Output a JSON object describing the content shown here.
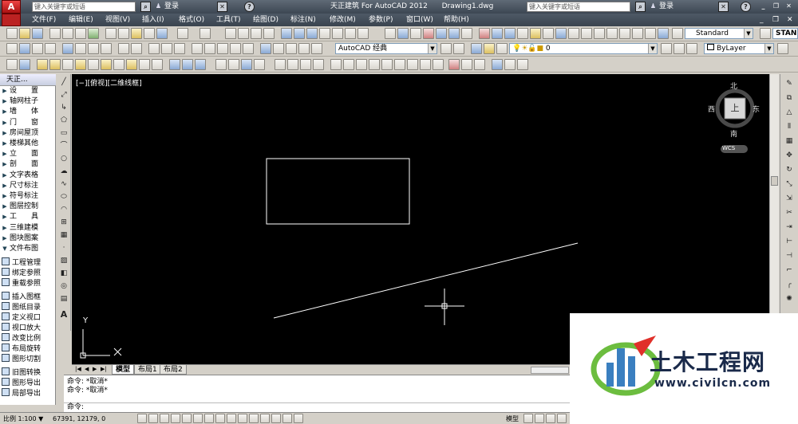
{
  "title_bar": {
    "app_title": "天正建筑 For AutoCAD 2012",
    "drawing": "Drawing1.dwg",
    "search_placeholder_left": "键入关键字或短语",
    "search_placeholder_right": "键入关键字或短语",
    "login_left": "登录",
    "login_right": "登录"
  },
  "menu": [
    "文件(F)",
    "编辑(E)",
    "视图(V)",
    "插入(I)",
    "格式(O)",
    "工具(T)",
    "绘图(D)",
    "标注(N)",
    "修改(M)",
    "参数(P)",
    "窗口(W)",
    "帮助(H)"
  ],
  "toolbars": {
    "text_style": "Standard",
    "workspace": "AutoCAD 经典",
    "layer": "0",
    "linetype": "ByLayer",
    "right_partial": "STAN"
  },
  "viewport_label": "[−][俯视][二维线框]",
  "left_panel": {
    "title": "天正...",
    "items": [
      "设　　置",
      "轴网柱子",
      "墙　　体",
      "门　　窗",
      "房间屋顶",
      "楼梯其他",
      "立　　面",
      "剖　　面",
      "文字表格",
      "尺寸标注",
      "符号标注",
      "图层控制",
      "工　　具",
      "三维建模",
      "图块图案",
      "文件布图"
    ],
    "sub_items": [
      "工程管理",
      "绑定参照",
      "重载参照",
      "插入图框",
      "图纸目录",
      "定义视口",
      "视口放大",
      "改变比例",
      "布局旋转",
      "图形切割",
      "旧图转换",
      "图形导出",
      "局部导出"
    ]
  },
  "viewcube": {
    "north": "北",
    "south": "南",
    "east": "东",
    "west": "西",
    "top": "上",
    "wcs": "WCS"
  },
  "ucs": {
    "x": "X",
    "y": "Y"
  },
  "tabs": [
    "模型",
    "布局1",
    "布局2"
  ],
  "command": {
    "lines": [
      "命令: *取消*",
      "命令: *取消*"
    ],
    "prompt": "命令:"
  },
  "status": {
    "scale": "比例 1:100 ▼",
    "coords": "67391, 12179, 0",
    "model": "模型"
  },
  "watermark": {
    "brand": "土木工程网",
    "url": "www.civilcn.com"
  },
  "colors": {
    "canvas": "#000000",
    "accent": "#3a7fc0",
    "brand_red": "#e0302a",
    "brand_green": "#6cbd3f"
  }
}
